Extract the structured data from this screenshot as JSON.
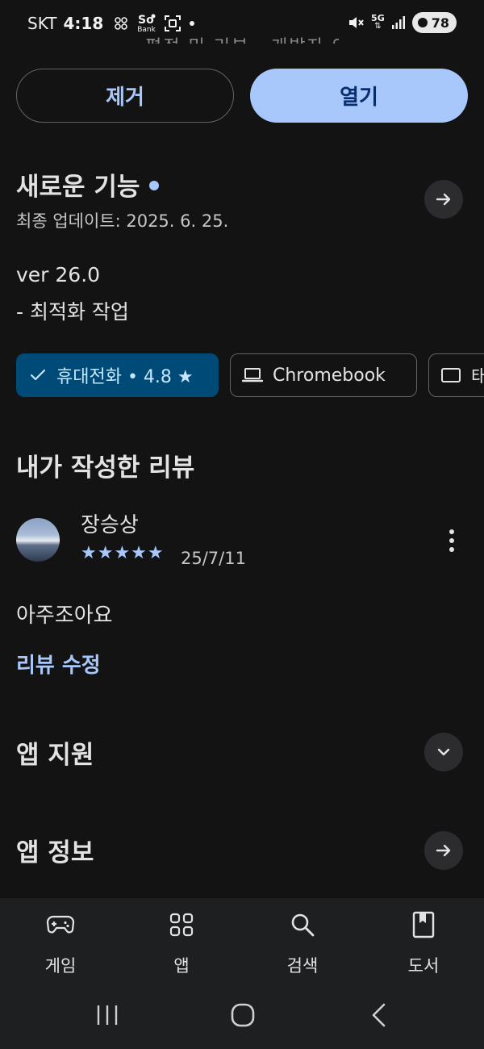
{
  "status": {
    "carrier": "SKT",
    "time": "4:18",
    "battery": "78",
    "network": "5G",
    "bank_app_label": "Bank",
    "status_icons": [
      "sync-icon",
      "sol-bank-icon",
      "screenshot-icon",
      "dot-icon",
      "mute-icon",
      "5g-icon",
      "signal-icon",
      "battery-icon"
    ]
  },
  "header_partial_text": "평점 및 리뷰 · 개발자 연락처",
  "actions": {
    "remove": "제거",
    "open": "열기"
  },
  "whats_new": {
    "title": "새로운 기능",
    "updated": "최종 업데이트: 2025. 6. 25.",
    "notes": [
      "ver 26.0",
      "- 최적화 작업"
    ]
  },
  "device_chips": [
    {
      "label": "휴대전화 • 4.8 ★",
      "icon": "check-icon",
      "selected": true
    },
    {
      "label": "Chromebook",
      "icon": "laptop-icon",
      "selected": false
    },
    {
      "label": "태블릿",
      "icon": "tablet-icon",
      "selected": false
    }
  ],
  "my_review": {
    "title": "내가 작성한 리뷰",
    "author": "장승상",
    "stars": "★★★★★",
    "rating": 5,
    "date": "25/7/11",
    "text": "아주조아요",
    "edit": "리뷰 수정"
  },
  "sections": {
    "app_support": "앱 지원",
    "about_app": "앱 정보"
  },
  "bottom_nav": [
    {
      "label": "게임",
      "icon": "gamepad-icon"
    },
    {
      "label": "앱",
      "icon": "apps-grid-icon"
    },
    {
      "label": "검색",
      "icon": "search-icon"
    },
    {
      "label": "도서",
      "icon": "book-icon"
    }
  ],
  "colors": {
    "background": "#131314",
    "accent": "#a8c7fa",
    "primary_button_text": "#062e6f",
    "selected_chip": "#004a77",
    "nav_background": "#1e1f20"
  }
}
